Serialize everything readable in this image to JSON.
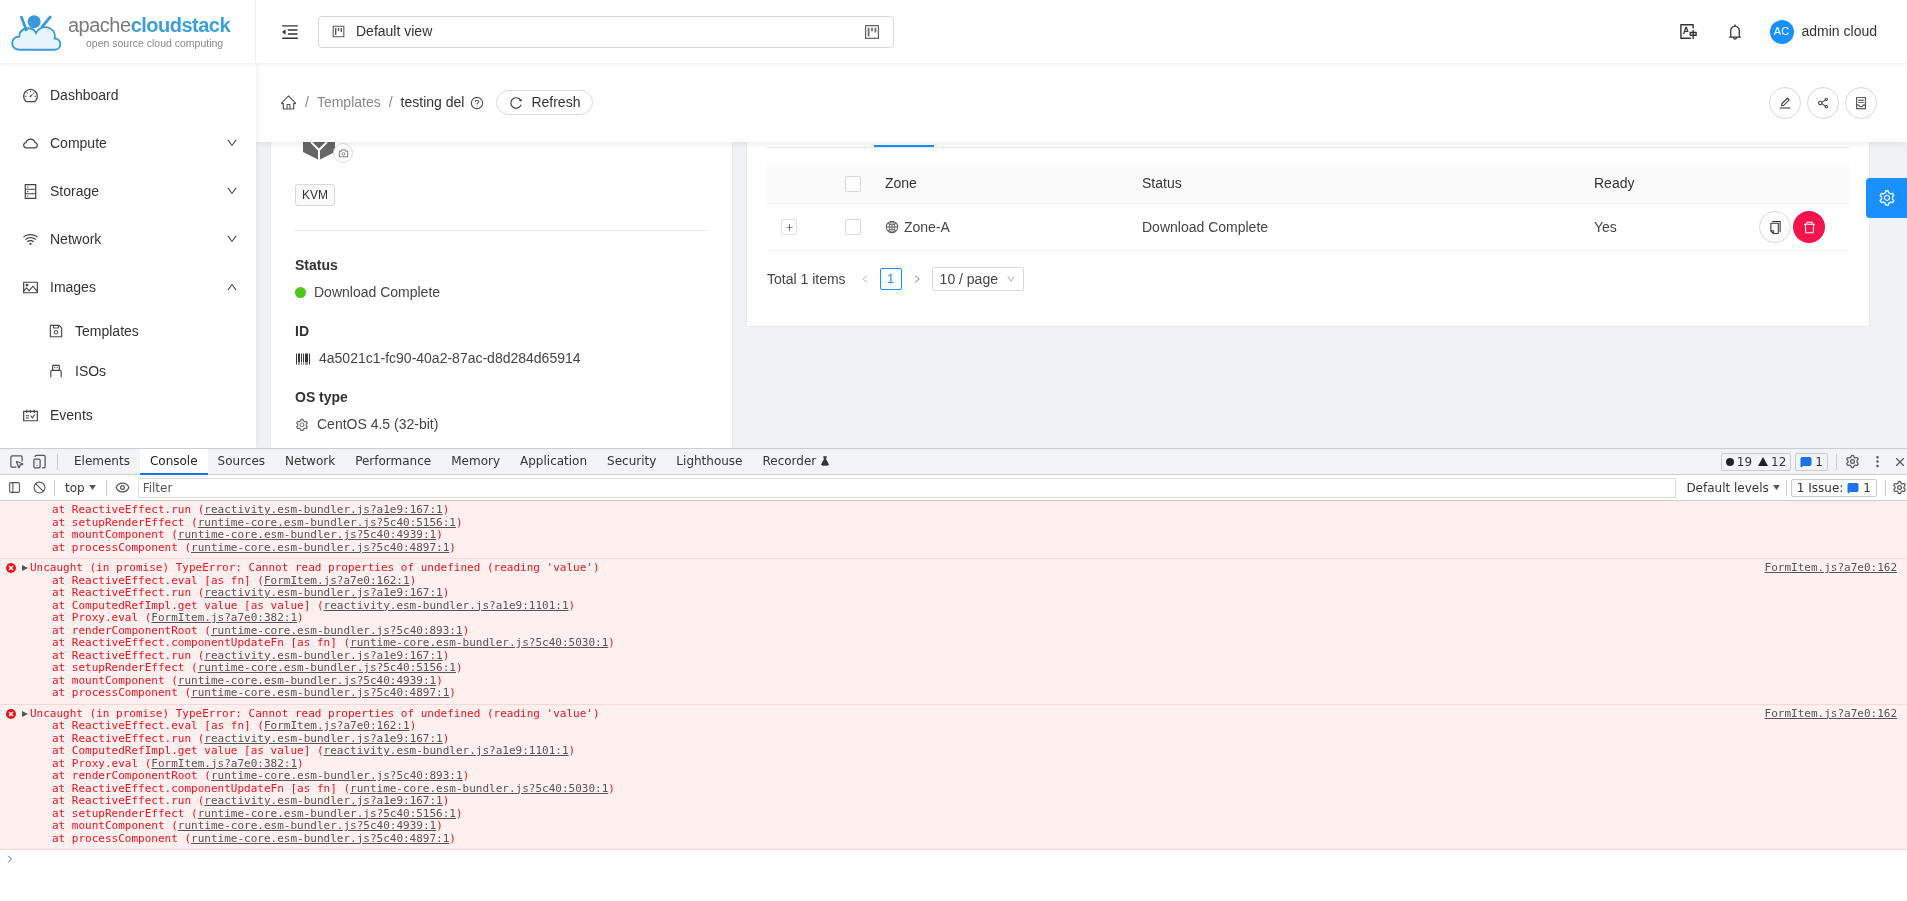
{
  "logo": {
    "brand_a": "apache",
    "brand_b": "cloudstack",
    "tagline": "open source cloud computing"
  },
  "header": {
    "view_selector": "Default view",
    "user": {
      "initials": "AC",
      "name": "admin cloud"
    }
  },
  "sidebar": {
    "items": [
      {
        "kind": "link",
        "label": "Dashboard"
      },
      {
        "kind": "group",
        "label": "Compute",
        "expanded": false
      },
      {
        "kind": "group",
        "label": "Storage",
        "expanded": false
      },
      {
        "kind": "group",
        "label": "Network",
        "expanded": false
      },
      {
        "kind": "group",
        "label": "Images",
        "expanded": true,
        "children": [
          {
            "label": "Templates"
          },
          {
            "label": "ISOs"
          }
        ]
      },
      {
        "kind": "link",
        "label": "Events"
      }
    ]
  },
  "breadcrumb": {
    "separator": "/",
    "items": [
      "Templates",
      "testing del"
    ],
    "refresh": "Refresh"
  },
  "details": {
    "tag": "KVM",
    "fields": [
      {
        "label": "Status",
        "value": "Download Complete",
        "color": "#52c41a"
      },
      {
        "label": "ID",
        "value": "4a5021c1-fc90-40a2-87ac-d8d284d65914"
      },
      {
        "label": "OS type",
        "value": "CentOS 4.5 (32-bit)"
      }
    ]
  },
  "table": {
    "header_checked": false,
    "columns": [
      "Zone",
      "Status",
      "Ready"
    ],
    "rows": [
      {
        "zone": "Zone-A",
        "status": "Download Complete",
        "ready": "Yes",
        "checked": false,
        "expanded": false
      }
    ],
    "pagination": {
      "total": "Total 1 items",
      "pages": [
        {
          "label": "1",
          "selected": true
        }
      ],
      "page_size": "10 / page"
    }
  },
  "devtools": {
    "tabs": [
      {
        "label": "Elements",
        "selected": false
      },
      {
        "label": "Console",
        "selected": true
      },
      {
        "label": "Sources",
        "selected": false
      },
      {
        "label": "Network",
        "selected": false
      },
      {
        "label": "Performance",
        "selected": false
      },
      {
        "label": "Memory",
        "selected": false
      },
      {
        "label": "Application",
        "selected": false
      },
      {
        "label": "Security",
        "selected": false
      },
      {
        "label": "Lighthouse",
        "selected": false
      },
      {
        "label": "Recorder",
        "selected": false
      }
    ],
    "errors": "19",
    "warnings": "12",
    "messages": "1",
    "context": "top",
    "filter_placeholder": "Filter",
    "levels": "Default levels",
    "issues_label": "1 Issue:",
    "issues_count": "1",
    "console": [
      {
        "kind": "error",
        "stack": [
          {
            "at": "at ReactiveEffect.run (",
            "link": "reactivity.esm-bundler.js?a1e9:167:1",
            "end": ")"
          },
          {
            "at": "at setupRenderEffect (",
            "link": "runtime-core.esm-bundler.js?5c40:5156:1",
            "end": ")"
          },
          {
            "at": "at mountComponent (",
            "link": "runtime-core.esm-bundler.js?5c40:4939:1",
            "end": ")"
          },
          {
            "at": "at processComponent (",
            "link": "runtime-core.esm-bundler.js?5c40:4897:1",
            "end": ")"
          }
        ]
      },
      {
        "kind": "error",
        "expanded": false,
        "message": "Uncaught (in promise) TypeError: Cannot read properties of undefined (reading 'value')",
        "source": "FormItem.js?a7e0:162",
        "stack": [
          {
            "at": "at ReactiveEffect.eval [as fn] (",
            "link": "FormItem.js?a7e0:162:1",
            "end": ")"
          },
          {
            "at": "at ReactiveEffect.run (",
            "link": "reactivity.esm-bundler.js?a1e9:167:1",
            "end": ")"
          },
          {
            "at": "at ComputedRefImpl.get value [as value] (",
            "link": "reactivity.esm-bundler.js?a1e9:1101:1",
            "end": ")"
          },
          {
            "at": "at Proxy.eval (",
            "link": "FormItem.js?a7e0:382:1",
            "end": ")"
          },
          {
            "at": "at renderComponentRoot (",
            "link": "runtime-core.esm-bundler.js?5c40:893:1",
            "end": ")"
          },
          {
            "at": "at ReactiveEffect.componentUpdateFn [as fn] (",
            "link": "runtime-core.esm-bundler.js?5c40:5030:1",
            "end": ")"
          },
          {
            "at": "at ReactiveEffect.run (",
            "link": "reactivity.esm-bundler.js?a1e9:167:1",
            "end": ")"
          },
          {
            "at": "at setupRenderEffect (",
            "link": "runtime-core.esm-bundler.js?5c40:5156:1",
            "end": ")"
          },
          {
            "at": "at mountComponent (",
            "link": "runtime-core.esm-bundler.js?5c40:4939:1",
            "end": ")"
          },
          {
            "at": "at processComponent (",
            "link": "runtime-core.esm-bundler.js?5c40:4897:1",
            "end": ")"
          }
        ]
      },
      {
        "kind": "error",
        "expanded": false,
        "message": "Uncaught (in promise) TypeError: Cannot read properties of undefined (reading 'value')",
        "source": "FormItem.js?a7e0:162",
        "stack": [
          {
            "at": "at ReactiveEffect.eval [as fn] (",
            "link": "FormItem.js?a7e0:162:1",
            "end": ")"
          },
          {
            "at": "at ReactiveEffect.run (",
            "link": "reactivity.esm-bundler.js?a1e9:167:1",
            "end": ")"
          },
          {
            "at": "at ComputedRefImpl.get value [as value] (",
            "link": "reactivity.esm-bundler.js?a1e9:1101:1",
            "end": ")"
          },
          {
            "at": "at Proxy.eval (",
            "link": "FormItem.js?a7e0:382:1",
            "end": ")"
          },
          {
            "at": "at renderComponentRoot (",
            "link": "runtime-core.esm-bundler.js?5c40:893:1",
            "end": ")"
          },
          {
            "at": "at ReactiveEffect.componentUpdateFn [as fn] (",
            "link": "runtime-core.esm-bundler.js?5c40:5030:1",
            "end": ")"
          },
          {
            "at": "at ReactiveEffect.run (",
            "link": "reactivity.esm-bundler.js?a1e9:167:1",
            "end": ")"
          },
          {
            "at": "at setupRenderEffect (",
            "link": "runtime-core.esm-bundler.js?5c40:5156:1",
            "end": ")"
          },
          {
            "at": "at mountComponent (",
            "link": "runtime-core.esm-bundler.js?5c40:4939:1",
            "end": ")"
          },
          {
            "at": "at processComponent (",
            "link": "runtime-core.esm-bundler.js?5c40:4897:1",
            "end": ")"
          }
        ]
      }
    ]
  }
}
